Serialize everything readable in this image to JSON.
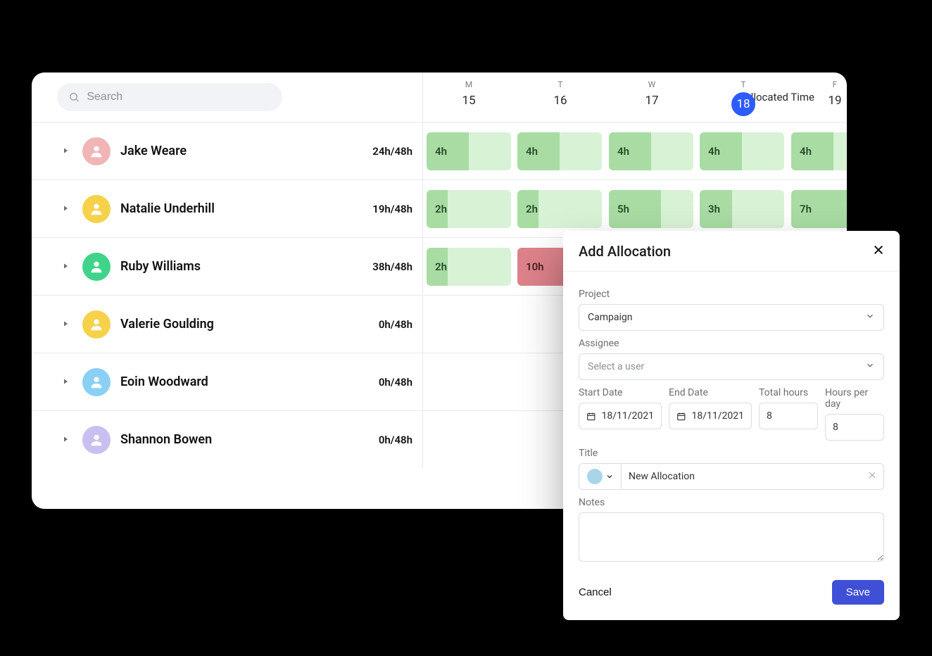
{
  "search": {
    "placeholder": "Search"
  },
  "allocated_time_label": "Allocated Time",
  "days": [
    {
      "dow": "M",
      "num": "15",
      "today": false
    },
    {
      "dow": "T",
      "num": "16",
      "today": false
    },
    {
      "dow": "W",
      "num": "17",
      "today": false
    },
    {
      "dow": "T",
      "num": "18",
      "today": true
    },
    {
      "dow": "F",
      "num": "19",
      "today": false
    }
  ],
  "people": [
    {
      "name": "Jake Weare",
      "avatar_bg": "#f2b5b5",
      "alloc": "24h/48h",
      "cells": [
        {
          "label": "4h",
          "kind": "green",
          "fill": 0.5
        },
        {
          "label": "4h",
          "kind": "green",
          "fill": 0.5
        },
        {
          "label": "4h",
          "kind": "green",
          "fill": 0.5
        },
        {
          "label": "4h",
          "kind": "green",
          "fill": 0.5
        },
        {
          "label": "4h",
          "kind": "green",
          "fill": 0.5
        }
      ]
    },
    {
      "name": "Natalie Underhill",
      "avatar_bg": "#f6d24a",
      "alloc": "19h/48h",
      "cells": [
        {
          "label": "2h",
          "kind": "green",
          "fill": 0.25
        },
        {
          "label": "2h",
          "kind": "green",
          "fill": 0.25
        },
        {
          "label": "5h",
          "kind": "green",
          "fill": 0.62
        },
        {
          "label": "3h",
          "kind": "green",
          "fill": 0.38
        },
        {
          "label": "7h",
          "kind": "green",
          "fill": 0.88
        }
      ]
    },
    {
      "name": "Ruby Williams",
      "avatar_bg": "#3fd48a",
      "alloc": "38h/48h",
      "cells": [
        {
          "label": "2h",
          "kind": "green",
          "fill": 0.25
        },
        {
          "label": "10h",
          "kind": "red",
          "fill": 1.0
        }
      ]
    },
    {
      "name": "Valerie Goulding",
      "avatar_bg": "#f6d24a",
      "alloc": "0h/48h",
      "cells": []
    },
    {
      "name": "Eoin Woodward",
      "avatar_bg": "#8ad0f5",
      "alloc": "0h/48h",
      "cells": []
    },
    {
      "name": "Shannon Bowen",
      "avatar_bg": "#c9bff0",
      "alloc": "0h/48h",
      "cells": []
    }
  ],
  "dialog": {
    "title": "Add Allocation",
    "project_label": "Project",
    "project_value": "Campaign",
    "assignee_label": "Assignee",
    "assignee_placeholder": "Select a user",
    "start_date_label": "Start Date",
    "end_date_label": "End Date",
    "total_hours_label": "Total hours",
    "hours_per_day_label": "Hours per day",
    "start_date_value": "18/11/2021",
    "end_date_value": "18/11/2021",
    "total_hours_value": "8",
    "hours_per_day_value": "8",
    "title_label": "Title",
    "title_value": "New Allocation",
    "title_color": "#a8d6e8",
    "notes_label": "Notes",
    "cancel_label": "Cancel",
    "save_label": "Save"
  }
}
